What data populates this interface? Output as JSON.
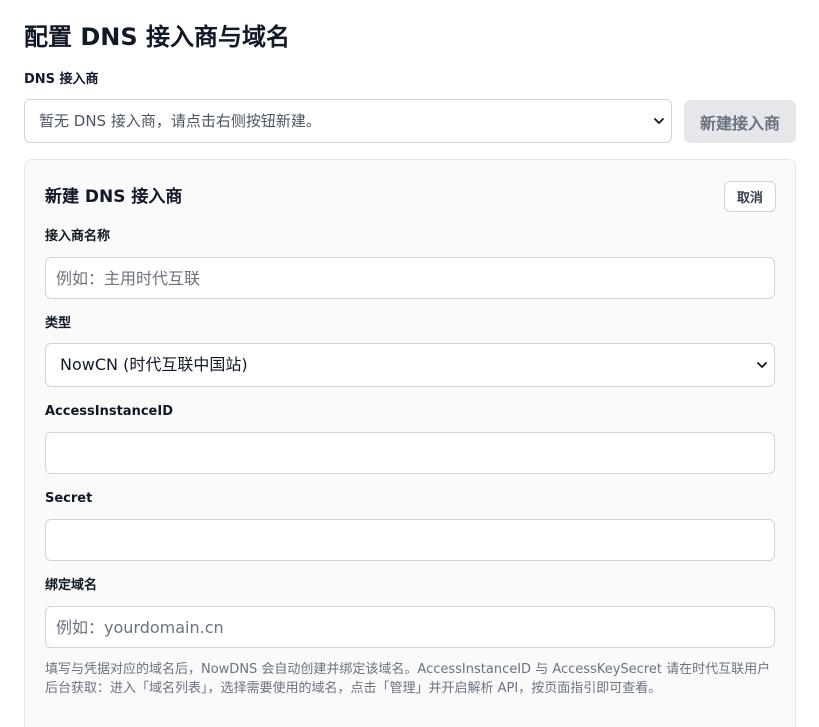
{
  "page": {
    "title": "配置 DNS 接入商与域名"
  },
  "provider": {
    "label": "DNS 接入商",
    "select_value": "暂无 DNS 接入商，请点击右侧按钮新建。",
    "new_button_label": "新建接入商"
  },
  "form": {
    "title": "新建 DNS 接入商",
    "cancel_label": "取消",
    "name_label": "接入商名称",
    "name_placeholder": "例如：主用时代互联",
    "type_label": "类型",
    "type_value": "NowCN (时代互联中国站)",
    "access_id_label": "AccessInstanceID",
    "access_id_value": "",
    "secret_label": "Secret",
    "secret_value": "",
    "domain_label": "绑定域名",
    "domain_placeholder": "例如：yourdomain.cn",
    "help_text": "填写与凭据对应的域名后，NowDNS 会自动创建并绑定该域名。AccessInstanceID 与 AccessKeySecret 请在时代互联用户后台获取：进入「域名列表」，选择需要使用的域名，点击「管理」并开启解析 API，按页面指引即可查看。"
  },
  "icons": {
    "select_arrow": "chevron-down-icon"
  },
  "colors": {
    "border": "#d1d5db",
    "disabled_button_bg": "#e5e7eb",
    "muted_text": "#6b7280"
  }
}
